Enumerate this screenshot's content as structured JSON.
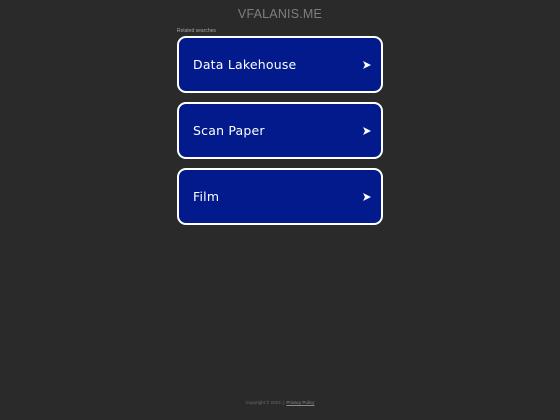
{
  "header": {
    "site_title": "VFALANIS.ME"
  },
  "related": {
    "label": "Related searches",
    "items": [
      {
        "label": "Data Lakehouse",
        "icon": "arrow-right-icon"
      },
      {
        "label": "Scan Paper",
        "icon": "arrow-right-icon"
      },
      {
        "label": "Film",
        "icon": "arrow-right-icon"
      }
    ]
  },
  "footer": {
    "copyright": "Copyright © 2023",
    "separator": "|",
    "privacy_label": "Privacy Policy"
  },
  "colors": {
    "background": "#2a2a2a",
    "button_fill": "#021a8c",
    "button_border": "#ffffff",
    "text_light": "#ffffff",
    "muted_text": "#7e7e7e"
  }
}
